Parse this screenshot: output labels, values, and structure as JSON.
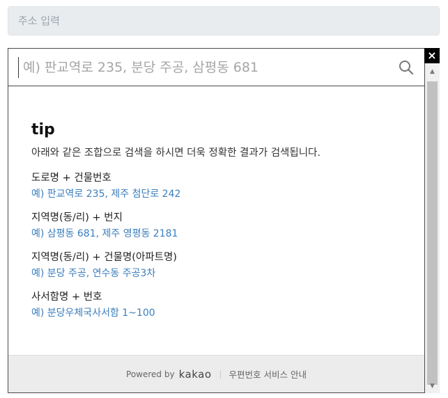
{
  "address_field": {
    "placeholder": "주소 입력"
  },
  "popup": {
    "close_label": "×",
    "search": {
      "placeholder": "예) 판교역로 235, 분당 주공, 삼평동 681"
    },
    "tip": {
      "title": "tip",
      "description": "아래와 같은 조합으로 검색을 하시면 더욱 정확한 결과가 검색됩니다.",
      "examples": [
        {
          "label": "도로명 + 건물번호",
          "value": "예) 판교역로 235,  제주 첨단로 242"
        },
        {
          "label": "지역명(동/리) + 번지",
          "value": "예) 삼평동 681,  제주 영평동 2181"
        },
        {
          "label": "지역명(동/리) + 건물명(아파트명)",
          "value": "예) 분당 주공,  연수동 주공3차"
        },
        {
          "label": "사서함명 + 번호",
          "value": "예) 분당우체국사서함 1~100"
        }
      ]
    },
    "footer": {
      "powered_by": "Powered by",
      "brand": "kakao",
      "postal_guide": "우편번호 서비스 안내"
    }
  },
  "colors": {
    "link_blue": "#3a7ebd",
    "footer_bg": "#ececec",
    "input_bg": "#e9ecef"
  }
}
